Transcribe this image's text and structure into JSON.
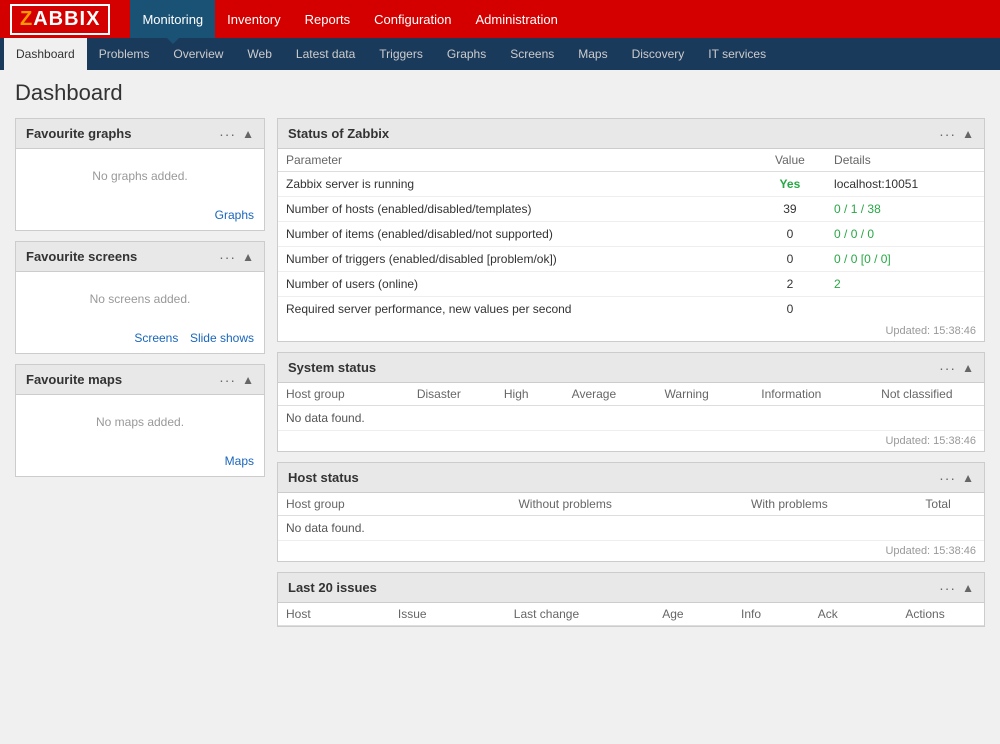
{
  "app": {
    "logo": "ZABBIX",
    "logo_z": "Z",
    "logo_rest": "ABBIX"
  },
  "top_nav": {
    "items": [
      {
        "label": "Monitoring",
        "active": true
      },
      {
        "label": "Inventory",
        "active": false
      },
      {
        "label": "Reports",
        "active": false
      },
      {
        "label": "Configuration",
        "active": false
      },
      {
        "label": "Administration",
        "active": false
      }
    ]
  },
  "second_nav": {
    "items": [
      {
        "label": "Dashboard",
        "active": true
      },
      {
        "label": "Problems",
        "active": false
      },
      {
        "label": "Overview",
        "active": false
      },
      {
        "label": "Web",
        "active": false
      },
      {
        "label": "Latest data",
        "active": false
      },
      {
        "label": "Triggers",
        "active": false
      },
      {
        "label": "Graphs",
        "active": false
      },
      {
        "label": "Screens",
        "active": false
      },
      {
        "label": "Maps",
        "active": false
      },
      {
        "label": "Discovery",
        "active": false
      },
      {
        "label": "IT services",
        "active": false
      }
    ]
  },
  "page_title": "Dashboard",
  "fav_graphs": {
    "title": "Favourite graphs",
    "empty_text": "No graphs added.",
    "link": "Graphs"
  },
  "fav_screens": {
    "title": "Favourite screens",
    "empty_text": "No screens added.",
    "link1": "Screens",
    "link2": "Slide shows"
  },
  "fav_maps": {
    "title": "Favourite maps",
    "empty_text": "No maps added.",
    "link": "Maps"
  },
  "status_zabbix": {
    "title": "Status of Zabbix",
    "col_param": "Parameter",
    "col_value": "Value",
    "col_details": "Details",
    "rows": [
      {
        "param": "Zabbix server is running",
        "value": "Yes",
        "details": "localhost:10051",
        "value_class": "val-yes",
        "details_class": "val-normal"
      },
      {
        "param": "Number of hosts (enabled/disabled/templates)",
        "value": "39",
        "details": "0 / 1 / 38",
        "value_class": "val-normal",
        "details_class": "val-green"
      },
      {
        "param": "Number of items (enabled/disabled/not supported)",
        "value": "0",
        "details": "0 / 0 / 0",
        "value_class": "val-normal",
        "details_class": "val-green"
      },
      {
        "param": "Number of triggers (enabled/disabled [problem/ok])",
        "value": "0",
        "details": "0 / 0 [0 / 0]",
        "value_class": "val-normal",
        "details_class": "val-green"
      },
      {
        "param": "Number of users (online)",
        "value": "2",
        "details": "2",
        "value_class": "val-normal",
        "details_class": "val-green"
      },
      {
        "param": "Required server performance, new values per second",
        "value": "0",
        "details": "",
        "value_class": "val-normal",
        "details_class": "val-normal"
      }
    ],
    "updated": "Updated: 15:38:46"
  },
  "system_status": {
    "title": "System status",
    "cols": [
      "Host group",
      "Disaster",
      "High",
      "Average",
      "Warning",
      "Information",
      "Not classified"
    ],
    "no_data": "No data found.",
    "updated": "Updated: 15:38:46"
  },
  "host_status": {
    "title": "Host status",
    "cols": [
      "Host group",
      "Without problems",
      "With problems",
      "Total"
    ],
    "no_data": "No data found.",
    "updated": "Updated: 15:38:46"
  },
  "last20": {
    "title": "Last 20 issues",
    "cols": [
      "Host",
      "Issue",
      "Last change",
      "Age",
      "Info",
      "Ack",
      "Actions"
    ]
  }
}
